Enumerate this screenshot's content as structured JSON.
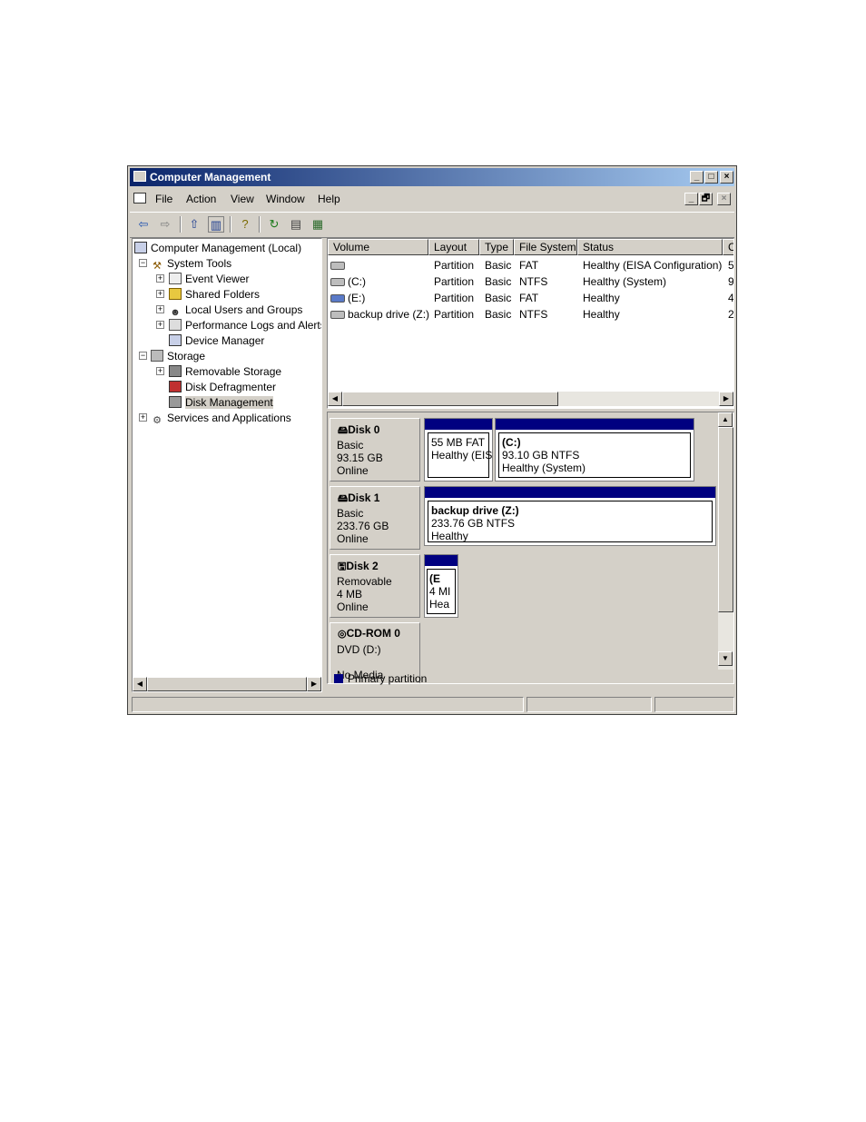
{
  "window": {
    "title": "Computer Management",
    "caption_buttons": [
      "_",
      "□",
      "×"
    ],
    "mdi_buttons": [
      "_",
      "🗗",
      "×"
    ]
  },
  "menu": {
    "items": [
      "File",
      "Action",
      "View",
      "Window",
      "Help"
    ]
  },
  "toolbar": {
    "icons": [
      "back-icon",
      "forward-icon",
      "up-folder-icon",
      "show-hide-tree-icon",
      "help-icon",
      "refresh-icon",
      "properties-icon",
      "export-list-icon"
    ]
  },
  "tree": {
    "root": "Computer Management (Local)",
    "items": [
      {
        "label": "System Tools"
      },
      {
        "label": "Event Viewer"
      },
      {
        "label": "Shared Folders"
      },
      {
        "label": "Local Users and Groups"
      },
      {
        "label": "Performance Logs and Alerts"
      },
      {
        "label": "Device Manager"
      },
      {
        "label": "Storage"
      },
      {
        "label": "Removable Storage"
      },
      {
        "label": "Disk Defragmenter"
      },
      {
        "label": "Disk Management"
      },
      {
        "label": "Services and Applications"
      }
    ]
  },
  "volumes": {
    "columns": [
      "Volume",
      "Layout",
      "Type",
      "File System",
      "Status",
      "C"
    ],
    "rows": [
      {
        "volume": "",
        "layout": "Partition",
        "type": "Basic",
        "fs": "FAT",
        "status": "Healthy (EISA Configuration)",
        "c": "5"
      },
      {
        "volume": "(C:)",
        "layout": "Partition",
        "type": "Basic",
        "fs": "NTFS",
        "status": "Healthy (System)",
        "c": "9"
      },
      {
        "volume": "(E:)",
        "layout": "Partition",
        "type": "Basic",
        "fs": "FAT",
        "status": "Healthy",
        "c": "4"
      },
      {
        "volume": "backup drive (Z:)",
        "layout": "Partition",
        "type": "Basic",
        "fs": "NTFS",
        "status": "Healthy",
        "c": "2"
      }
    ]
  },
  "disks": [
    {
      "name": "Disk 0",
      "kind": "Basic",
      "size": "93.15 GB",
      "state": "Online",
      "partitions": [
        {
          "title": "",
          "size": "55 MB FAT",
          "status": "Healthy (EIS"
        },
        {
          "title": "(C:)",
          "size": "93.10 GB NTFS",
          "status": "Healthy (System)"
        }
      ]
    },
    {
      "name": "Disk 1",
      "kind": "Basic",
      "size": "233.76 GB",
      "state": "Online",
      "partitions": [
        {
          "title": "backup drive  (Z:)",
          "size": "233.76 GB NTFS",
          "status": "Healthy"
        }
      ]
    },
    {
      "name": "Disk 2",
      "kind": "Removable",
      "size": "4 MB",
      "state": "Online",
      "partitions": [
        {
          "title": "(E",
          "size": "4 MI",
          "status": "Hea"
        }
      ]
    },
    {
      "name": "CD-ROM 0",
      "kind": "DVD (D:)",
      "size": "",
      "state": "No Media",
      "partitions": []
    }
  ],
  "legend": {
    "primary_partition": "Primary partition",
    "primary_color": "#000080"
  }
}
